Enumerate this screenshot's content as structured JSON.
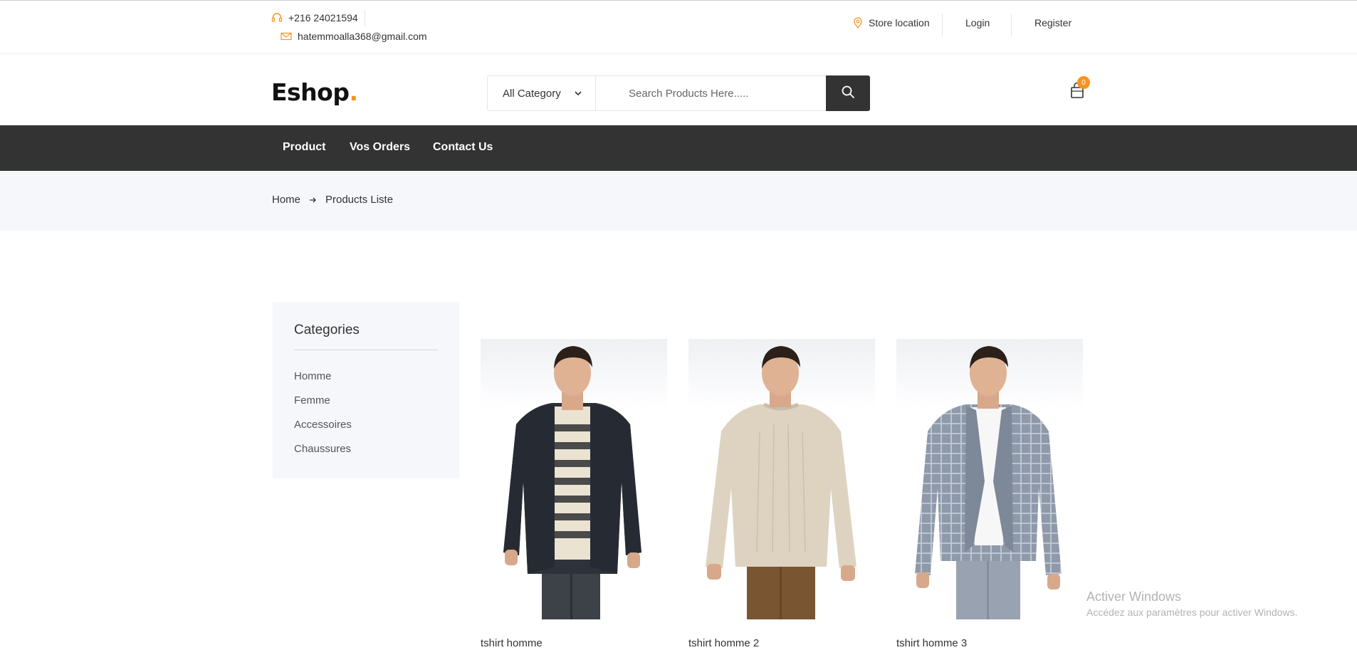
{
  "topbar": {
    "phone": "+216 24021594",
    "email": "hatemmoalla368@gmail.com",
    "store_location": "Store location",
    "login": "Login",
    "register": "Register"
  },
  "header": {
    "logo_text": "Eshop",
    "logo_dot": ".",
    "category_selected": "All Category",
    "search_placeholder": "Search Products Here.....",
    "cart_count": "0"
  },
  "nav": {
    "items": [
      "Product",
      "Vos Orders",
      "Contact Us"
    ]
  },
  "breadcrumb": {
    "home": "Home",
    "current": "Products Liste"
  },
  "sidebar": {
    "title": "Categories",
    "items": [
      "Homme",
      "Femme",
      "Accessoires",
      "Chaussures"
    ]
  },
  "products": [
    {
      "name": "tshirt homme"
    },
    {
      "name": "tshirt homme 2"
    },
    {
      "name": "tshirt homme 3"
    }
  ],
  "watermark": {
    "title": "Activer Windows",
    "subtitle": "Accédez aux paramètres pour activer Windows."
  },
  "colors": {
    "accent": "#f7941d",
    "nav_bg": "#333333",
    "panel_bg": "#f6f7fb"
  }
}
